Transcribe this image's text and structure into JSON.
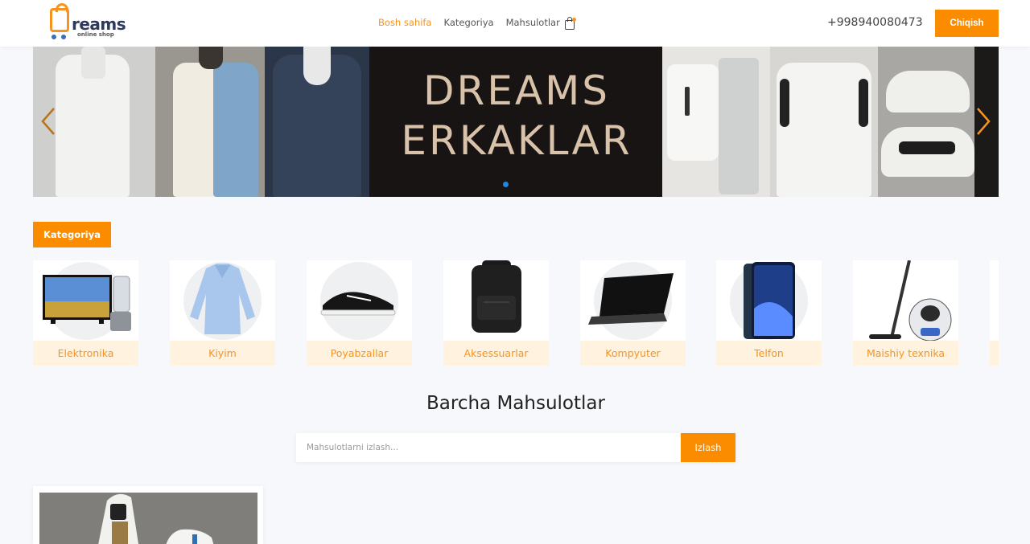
{
  "header": {
    "logo_text": "reams",
    "logo_sub": "online shop",
    "nav": [
      "Bosh sahifa",
      "Kategoriya",
      "Mahsulotlar"
    ],
    "phone": "+998940080473",
    "logout_label": "Chiqish",
    "icons": {
      "cart": "shopping-bag-icon"
    }
  },
  "banner": {
    "title_line1": "DREAMS",
    "title_line2": "ERKAKLAR"
  },
  "categories": {
    "button_label": "Kategoriya",
    "items": [
      {
        "label": "Elektronika"
      },
      {
        "label": "Kiyim"
      },
      {
        "label": "Poyabzallar"
      },
      {
        "label": "Aksessuarlar"
      },
      {
        "label": "Kompyuter"
      },
      {
        "label": "Telfon"
      },
      {
        "label": "Maishiy texnika"
      }
    ]
  },
  "products": {
    "title": "Barcha Mahsulotlar",
    "search_placeholder": "Mahsulotlarni izlash...",
    "search_button": "Izlash"
  },
  "colors": {
    "accent": "#fb8c00",
    "category_label_bg": "#fff3df",
    "banner_title": "#d9c2aa"
  }
}
